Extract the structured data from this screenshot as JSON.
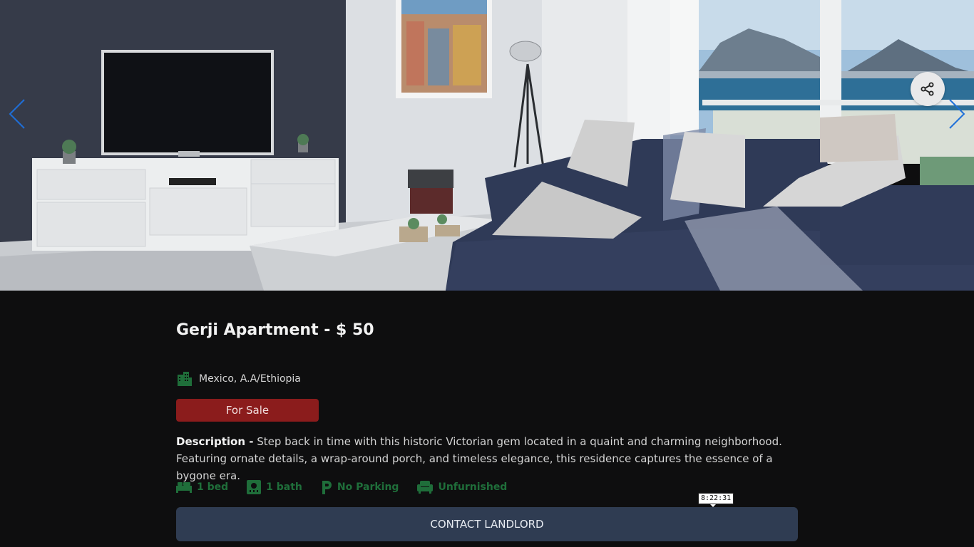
{
  "listing": {
    "title": "Gerji Apartment - $ 50",
    "location": "Mexico, A.A/Ethiopia",
    "status": "For Sale",
    "description_label": "Description -",
    "description": "Step back in time with this historic Victorian gem located in a quaint and charming neighborhood. Featuring ornate details, a wrap-around porch, and timeless elegance, this residence captures the essence of a bygone era."
  },
  "features": [
    {
      "icon": "bed-icon",
      "label": "1 bed"
    },
    {
      "icon": "bath-icon",
      "label": "1 bath"
    },
    {
      "icon": "parking-icon",
      "label": "No Parking"
    },
    {
      "icon": "sofa-icon",
      "label": "Unfurnished"
    }
  ],
  "actions": {
    "contact_label": "CONTACT LANDLORD"
  },
  "overlay": {
    "timestamp": "8:22:31"
  },
  "colors": {
    "background": "#0e0e0f",
    "accent_green": "#1f6e3a",
    "status_red": "#8b1c1c",
    "button_blue": "#2f3c52",
    "arrow_blue": "#1e6fd9"
  }
}
